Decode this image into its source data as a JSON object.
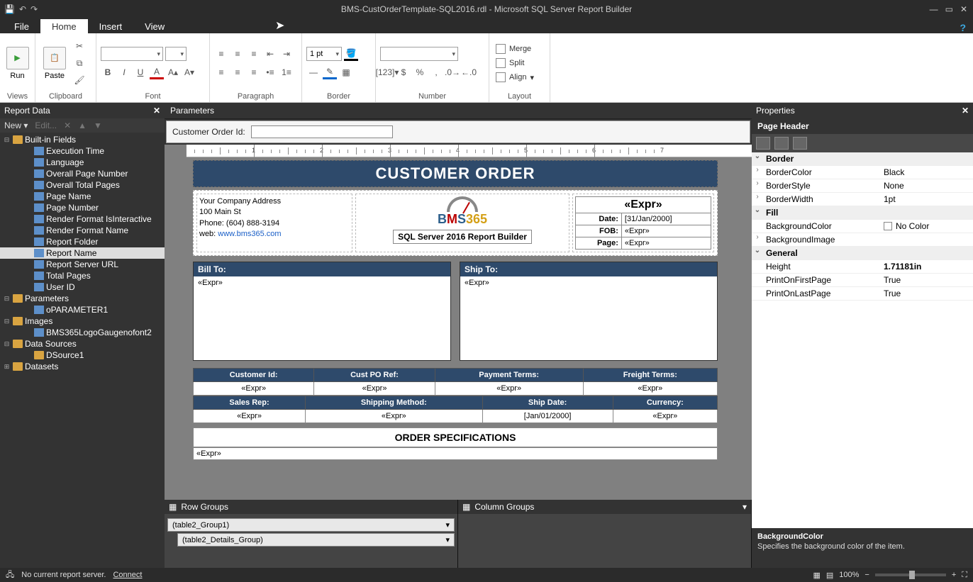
{
  "title": "BMS-CustOrderTemplate-SQL2016.rdl - Microsoft SQL Server Report Builder",
  "tabs": {
    "file": "File",
    "home": "Home",
    "insert": "Insert",
    "view": "View"
  },
  "ribbon": {
    "views": {
      "run": "Run",
      "label": "Views"
    },
    "clipboard": {
      "paste": "Paste",
      "label": "Clipboard"
    },
    "font": {
      "label": "Font",
      "size_ph": " "
    },
    "paragraph": {
      "label": "Paragraph"
    },
    "border": {
      "label": "Border",
      "width": "1 pt"
    },
    "number": {
      "label": "Number"
    },
    "layout": {
      "merge": "Merge",
      "split": "Split",
      "align": "Align",
      "label": "Layout"
    }
  },
  "reportdata": {
    "title": "Report Data",
    "new": "New",
    "edit": "Edit...",
    "builtins": {
      "label": "Built-in Fields",
      "items": [
        "Execution Time",
        "Language",
        "Overall Page Number",
        "Overall Total Pages",
        "Page Name",
        "Page Number",
        "Render Format IsInteractive",
        "Render Format Name",
        "Report Folder",
        "Report Name",
        "Report Server URL",
        "Total Pages",
        "User ID"
      ]
    },
    "parameters": {
      "label": "Parameters",
      "items": [
        "oPARAMETER1"
      ]
    },
    "images": {
      "label": "Images",
      "items": [
        "BMS365LogoGaugenofont2"
      ]
    },
    "datasources": {
      "label": "Data Sources",
      "items": [
        "DSource1"
      ]
    },
    "datasets": {
      "label": "Datasets"
    },
    "selected": "Report Name"
  },
  "parameters": {
    "title": "Parameters",
    "label": "Customer Order Id:"
  },
  "report": {
    "title": "CUSTOMER ORDER",
    "company": {
      "l1": "Your Company Address",
      "l2": "100 Main St",
      "l3": "Phone: (604) 888-3194",
      "l4pre": "web: ",
      "l4url": "www.bms365.com"
    },
    "logo_sub": "SQL Server 2016 Report Builder",
    "meta": {
      "expr": "«Expr»",
      "date_k": "Date:",
      "date_v": "[31/Jan/2000]",
      "fob_k": "FOB:",
      "fob_v": "«Expr»",
      "page_k": "Page:",
      "page_v": "«Expr»"
    },
    "billto": "Bill To:",
    "shipto": "Ship To:",
    "exprv": "«Expr»",
    "row1h": [
      "Customer Id:",
      "Cust PO Ref:",
      "Payment Terms:",
      "Freight Terms:"
    ],
    "row1v": [
      "«Expr»",
      "«Expr»",
      "«Expr»",
      "«Expr»"
    ],
    "row2h": [
      "Sales Rep:",
      "Shipping Method:",
      "Ship Date:",
      "Currency:"
    ],
    "row2v": [
      "«Expr»",
      "«Expr»",
      "[Jan/01/2000]",
      "«Expr»"
    ],
    "spec": "ORDER SPECIFICATIONS"
  },
  "groups": {
    "row_title": "Row Groups",
    "col_title": "Column Groups",
    "g1": "(table2_Group1)",
    "g2": "(table2_Details_Group)"
  },
  "properties": {
    "title": "Properties",
    "subject": "Page Header",
    "cats": {
      "border": "Border",
      "fill": "Fill",
      "general": "General"
    },
    "rows": {
      "bordercolor_k": "BorderColor",
      "bordercolor_v": "Black",
      "borderstyle_k": "BorderStyle",
      "borderstyle_v": "None",
      "borderwidth_k": "BorderWidth",
      "borderwidth_v": "1pt",
      "bgcolor_k": "BackgroundColor",
      "bgcolor_v": "No Color",
      "bgimg_k": "BackgroundImage",
      "bgimg_v": "",
      "height_k": "Height",
      "height_v": "1.71181in",
      "pofp_k": "PrintOnFirstPage",
      "pofp_v": "True",
      "polp_k": "PrintOnLastPage",
      "polp_v": "True"
    },
    "desc_t": "BackgroundColor",
    "desc_b": "Specifies the background color of the item."
  },
  "status": {
    "msg": "No current report server.",
    "connect": "Connect",
    "zoom": "100%"
  }
}
